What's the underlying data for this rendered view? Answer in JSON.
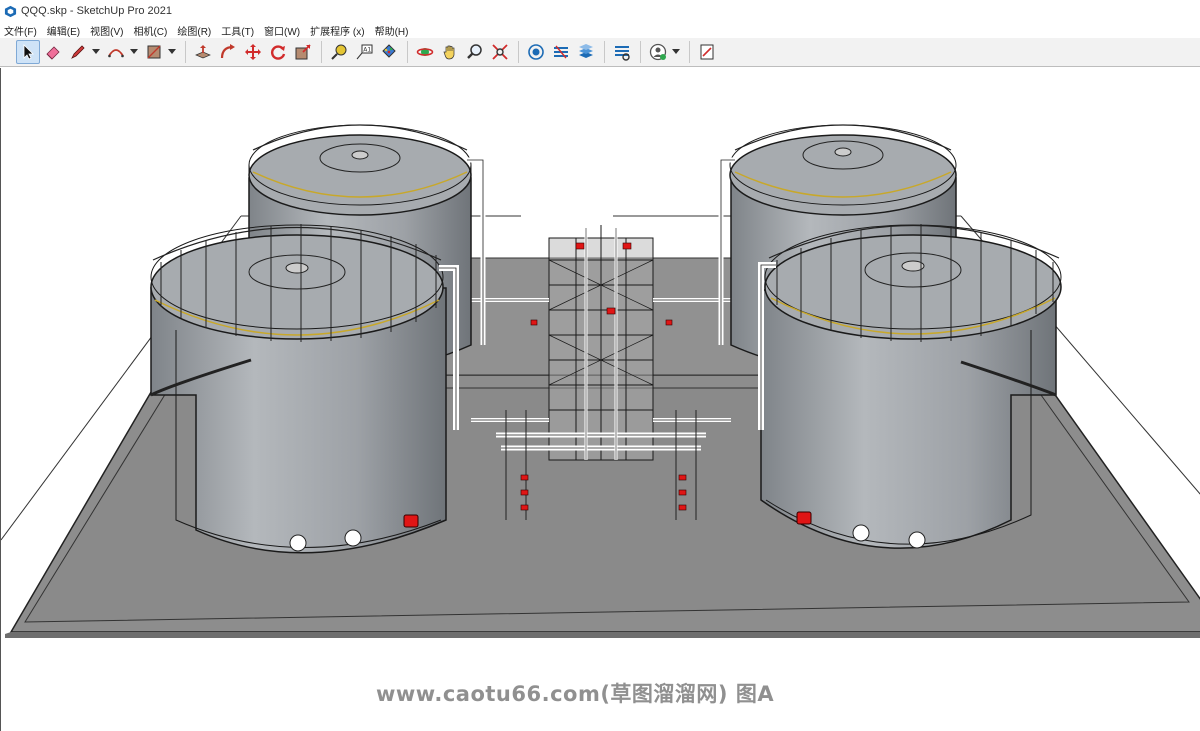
{
  "window": {
    "title": "QQQ.skp - SketchUp Pro 2021"
  },
  "menu": {
    "items": [
      {
        "label": "文件(F)"
      },
      {
        "label": "编辑(E)"
      },
      {
        "label": "视图(V)"
      },
      {
        "label": "相机(C)"
      },
      {
        "label": "绘图(R)"
      },
      {
        "label": "工具(T)"
      },
      {
        "label": "窗口(W)"
      },
      {
        "label": "扩展程序 (x)"
      },
      {
        "label": "帮助(H)"
      }
    ]
  },
  "toolbar": {
    "tools": [
      {
        "icon": "select-arrow-icon",
        "active": true
      },
      {
        "icon": "eraser-icon"
      },
      {
        "icon": "pencil-line-icon",
        "dropdown": true
      },
      {
        "icon": "arc-icon",
        "dropdown": true
      },
      {
        "icon": "rectangle-icon",
        "dropdown": true
      },
      {
        "icon": "push-pull-icon"
      },
      {
        "icon": "follow-me-icon"
      },
      {
        "icon": "move-icon"
      },
      {
        "icon": "rotate-icon"
      },
      {
        "icon": "scale-icon"
      },
      {
        "icon": "tape-measure-icon"
      },
      {
        "icon": "text-label-icon"
      },
      {
        "icon": "paint-bucket-icon"
      },
      {
        "icon": "orbit-icon"
      },
      {
        "icon": "pan-hand-icon"
      },
      {
        "icon": "zoom-icon"
      },
      {
        "icon": "zoom-extents-icon"
      },
      {
        "icon": "warehouse-icon"
      },
      {
        "icon": "extension-warehouse-icon"
      },
      {
        "icon": "layout-icon"
      },
      {
        "icon": "extension-manager-icon"
      },
      {
        "icon": "account-icon",
        "dropdown": true
      },
      {
        "icon": "notes-icon"
      }
    ]
  },
  "watermark": {
    "text": "www.caotu66.com(草图溜溜网) 图A"
  },
  "colors": {
    "tank_body": "#9fa4a9",
    "ground": "#8c8c8c",
    "railing": "#222222",
    "highlight_red": "#e01515",
    "selected_tool": "#cfe3f7"
  }
}
